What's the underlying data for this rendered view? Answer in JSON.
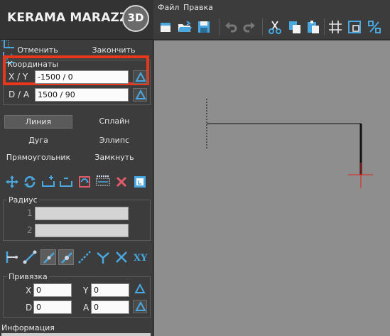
{
  "app": {
    "logo_text": "KERAMA MARAZZI",
    "logo_badge": "3D"
  },
  "menu": {
    "file": "Файл",
    "edit": "Правка"
  },
  "actions": {
    "cancel": "Отменить",
    "finish": "Закончить"
  },
  "coordinates": {
    "title": "Координаты",
    "xy_label": "X / Y",
    "xy_value": "-1500 / 0",
    "da_label": "D / A",
    "da_value": "1500 / 90"
  },
  "modes": {
    "line": "Линия",
    "spline": "Сплайн",
    "arc": "Дуга",
    "ellipse": "Эллипс",
    "rectangle": "Прямоугольник",
    "close": "Замкнуть",
    "selected": "line"
  },
  "radius": {
    "title": "Радиус",
    "label1": "1",
    "label2": "2",
    "value1": "",
    "value2": ""
  },
  "snap": {
    "title": "Привязка",
    "x_label": "X",
    "x_value": "0",
    "y_label": "Y",
    "y_value": "0",
    "d_label": "D",
    "d_value": "0",
    "a_label": "A",
    "a_value": "0"
  },
  "info": {
    "title": "Информация"
  },
  "colors": {
    "highlight": "#e8371b",
    "accent_blue": "#4aa8e0",
    "canvas_bg": "#8e8e8e",
    "cursor_red": "#e02020"
  },
  "icons": {
    "toolbar": [
      "new-file-icon",
      "open-folder-icon",
      "save-icon",
      "undo-icon",
      "redo-icon",
      "cut-icon",
      "copy-icon",
      "paste-icon",
      "grid-icon",
      "fit-view-icon",
      "percent-icon"
    ],
    "edit_tools": [
      "move-icon",
      "rotate-icon",
      "add-point-icon",
      "remove-point-icon",
      "reflect-icon",
      "dimension-icon",
      "delete-icon",
      "export-icon"
    ],
    "snap_tools": [
      "snap-endpoint-icon",
      "snap-line-icon",
      "snap-perpendicular-icon",
      "snap-parallel-icon",
      "snap-dashed-icon",
      "snap-bisector-icon",
      "snap-intersection-icon",
      "snap-xy-icon"
    ]
  }
}
